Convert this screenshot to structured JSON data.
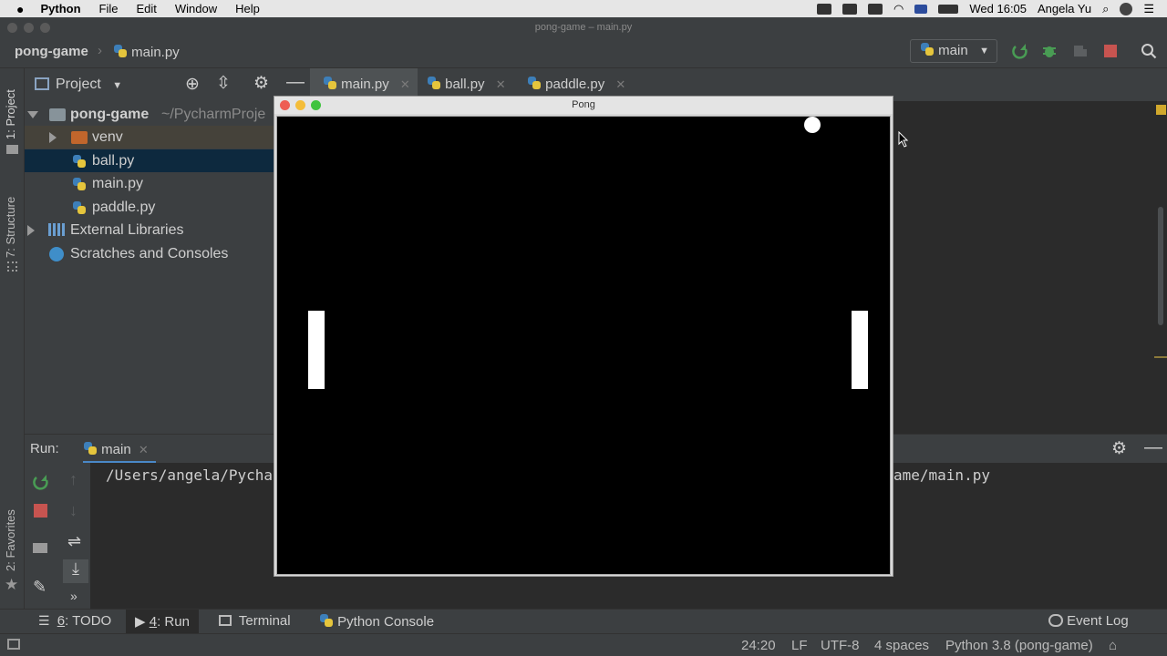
{
  "menubar": {
    "app": "Python",
    "items": [
      "File",
      "Edit",
      "Window",
      "Help"
    ],
    "clock": "Wed 16:05",
    "user": "Angela Yu"
  },
  "window": {
    "title": "pong-game – main.py"
  },
  "nav": {
    "project": "pong-game",
    "file": "main.py"
  },
  "run_config": {
    "label": "main"
  },
  "project_panel": {
    "title": "Project",
    "root": {
      "name": "pong-game",
      "path": "~/PycharmProje"
    },
    "items": [
      {
        "label": "venv"
      },
      {
        "label": "ball.py"
      },
      {
        "label": "main.py"
      },
      {
        "label": "paddle.py"
      },
      {
        "label": "External Libraries"
      },
      {
        "label": "Scratches and Consoles"
      }
    ]
  },
  "left_strip": {
    "project": "1: Project",
    "structure": "7: Structure",
    "favorites": "2: Favorites"
  },
  "tabs": [
    {
      "label": "main.py",
      "active": true
    },
    {
      "label": "ball.py",
      "active": false
    },
    {
      "label": "paddle.py",
      "active": false
    }
  ],
  "run_panel": {
    "title": "Run:",
    "tab": "main",
    "console_left": "/Users/angela/Pychar",
    "console_right": "ame/main.py"
  },
  "bottom_tools": [
    {
      "num": "6",
      "label": ": TODO"
    },
    {
      "num": "4",
      "label": ": Run"
    },
    {
      "num": "",
      "label": "Terminal"
    },
    {
      "num": "",
      "label": "Python Console"
    }
  ],
  "event_log": "Event Log",
  "status": {
    "position": "24:20",
    "line_sep": "LF",
    "encoding": "UTF-8",
    "indent": "4 spaces",
    "interpreter": "Python 3.8 (pong-game)"
  },
  "pong": {
    "title": "Pong",
    "ball": {
      "color": "#ffffff"
    },
    "background": "#000000"
  },
  "colors": {
    "accent": "#4a88c7",
    "run_green": "#499c54",
    "stop_red": "#c75450"
  }
}
